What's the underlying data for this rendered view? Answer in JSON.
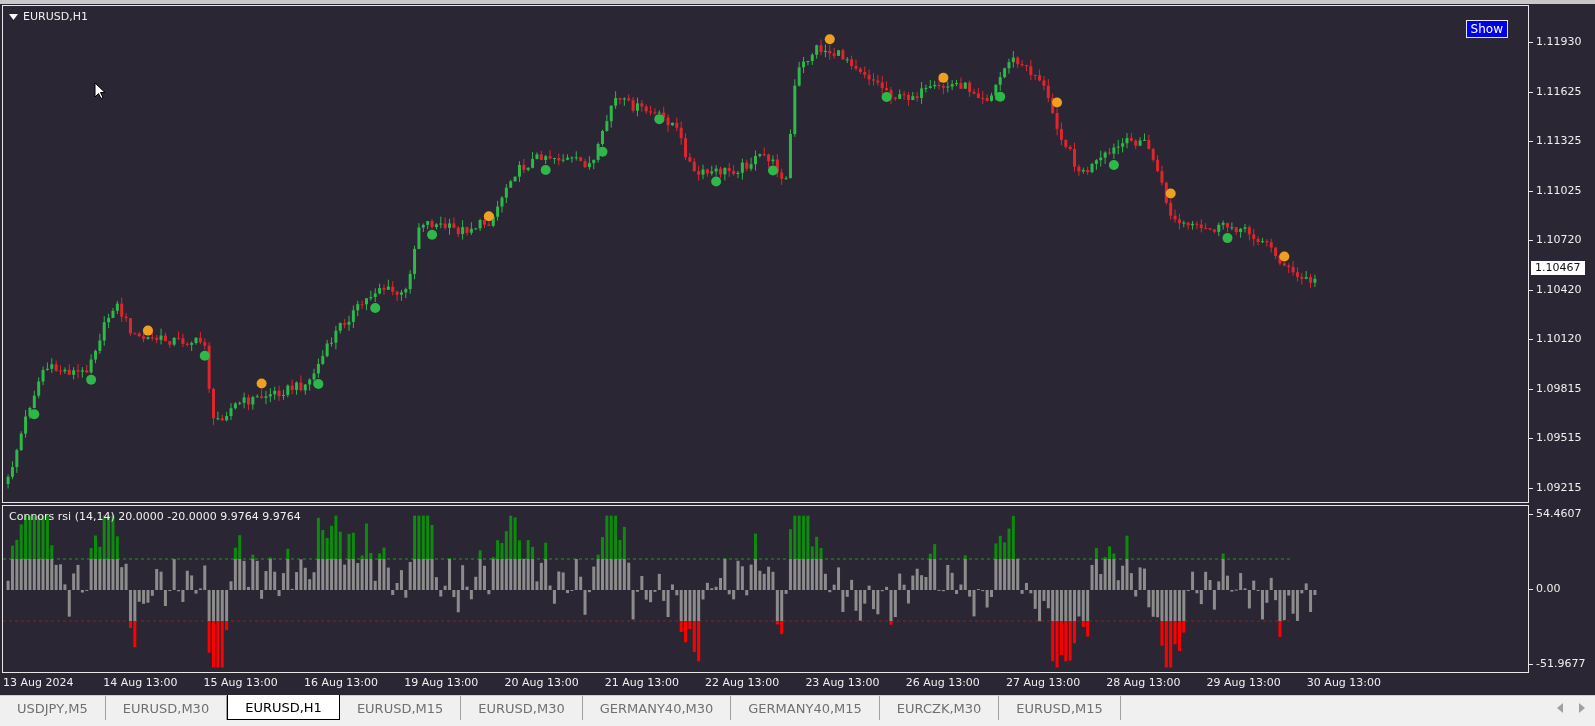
{
  "chart": {
    "title": "EURUSD,H1",
    "show_button": "Show",
    "current_price": "1.10467",
    "price_axis": [
      "1.11930",
      "1.11625",
      "1.11325",
      "1.11025",
      "1.10720",
      "1.10420",
      "1.10120",
      "1.09815",
      "1.09515",
      "1.09215"
    ]
  },
  "indicator": {
    "label": "Connors rsi (14,14) 20.0000 -20.0000 9.9764 9.9764",
    "axis": [
      "54.4607",
      "0.00",
      "-51.9677"
    ]
  },
  "time_axis": [
    "13 Aug 2024",
    "14 Aug 13:00",
    "15 Aug 13:00",
    "16 Aug 13:00",
    "19 Aug 13:00",
    "20 Aug 13:00",
    "21 Aug 13:00",
    "22 Aug 13:00",
    "23 Aug 13:00",
    "26 Aug 13:00",
    "27 Aug 13:00",
    "28 Aug 13:00",
    "29 Aug 13:00",
    "30 Aug 13:00"
  ],
  "tabs": [
    {
      "label": "USDJPY,M5",
      "selected": false
    },
    {
      "label": "EURUSD,M30",
      "selected": false
    },
    {
      "label": "EURUSD,H1",
      "selected": true
    },
    {
      "label": "EURUSD,M15",
      "selected": false
    },
    {
      "label": "EURUSD,M30",
      "selected": false
    },
    {
      "label": "GERMANY40,M30",
      "selected": false
    },
    {
      "label": "GERMANY40,M15",
      "selected": false
    },
    {
      "label": "EURCZK,M30",
      "selected": false
    },
    {
      "label": "EURUSD,M15",
      "selected": false
    }
  ]
}
